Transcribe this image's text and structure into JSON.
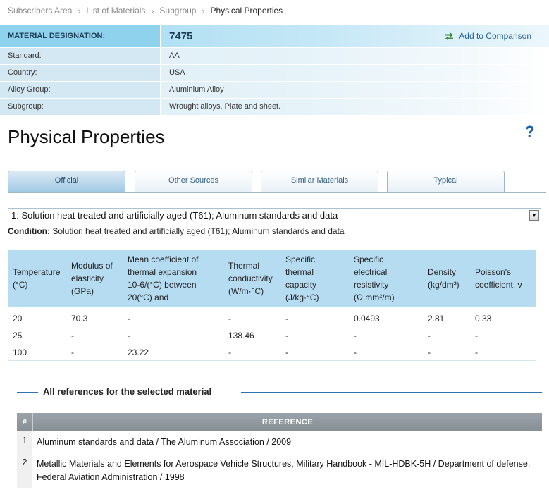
{
  "breadcrumb": {
    "items": [
      "Subscribers Area",
      "List of Materials",
      "Subgroup"
    ],
    "current": "Physical Properties"
  },
  "designation": {
    "label": "MATERIAL DESIGNATION:",
    "value": "7475",
    "add_to_comparison": "Add to Comparison",
    "rows": [
      {
        "label": "Standard:",
        "value": "AA"
      },
      {
        "label": "Country:",
        "value": "USA"
      },
      {
        "label": "Alloy Group:",
        "value": "Aluminium Alloy"
      },
      {
        "label": "Subgroup:",
        "value": "Wrought alloys. Plate and sheet."
      }
    ]
  },
  "page_title": "Physical Properties",
  "help_icon_glyph": "?",
  "tabs": [
    {
      "label": "Official",
      "active": true
    },
    {
      "label": "Other Sources",
      "active": false
    },
    {
      "label": "Similar Materials",
      "active": false
    },
    {
      "label": "Typical",
      "active": false
    }
  ],
  "condition_select": {
    "selected": "1: Solution heat treated and artificially aged (T61); Aluminum standards and data"
  },
  "condition": {
    "label": "Condition:",
    "text": " Solution heat treated and artificially aged (T61); Aluminum standards and data"
  },
  "properties_table": {
    "headers": [
      [
        "Temperature",
        "(°C)"
      ],
      [
        "Modulus of",
        "elasticity",
        "(GPa)"
      ],
      [
        "Mean coefficient of",
        "thermal expansion",
        "10-6/(°C) between",
        "20(°C) and"
      ],
      [
        "Thermal",
        "conductivity",
        "(W/m·°C)"
      ],
      [
        "Specific",
        "thermal",
        "capacity",
        "(J/kg·°C)"
      ],
      [
        "Specific",
        "electrical",
        "resistivity",
        "(Ω mm²/m)"
      ],
      [
        "Density",
        "(kg/dm³)"
      ],
      [
        "Poisson's",
        "coefficient, ν"
      ]
    ],
    "rows": [
      [
        "20",
        "70.3",
        "-",
        "-",
        "-",
        "0.0493",
        "2.81",
        "0.33"
      ],
      [
        "25",
        "-",
        "-",
        "138.46",
        "-",
        "-",
        "-",
        "-"
      ],
      [
        "100",
        "-",
        "23.22",
        "-",
        "-",
        "-",
        "-",
        "-"
      ]
    ]
  },
  "references": {
    "heading": "All references for the selected material",
    "col_num": "#",
    "col_ref": "REFERENCE",
    "items": [
      {
        "num": "1",
        "text": "Aluminum standards and data / The Aluminum Association / 2009"
      },
      {
        "num": "2",
        "text": "Metallic Materials and Elements for Aerospace Vehicle Structures, Military Handbook - MIL-HDBK-5H / Department of defense, Federal Aviation Administration / 1998"
      }
    ]
  },
  "colors": {
    "accent": "#2d73b1",
    "header_blue": "#9fd9f1",
    "table_header": "#b6dcf2"
  }
}
